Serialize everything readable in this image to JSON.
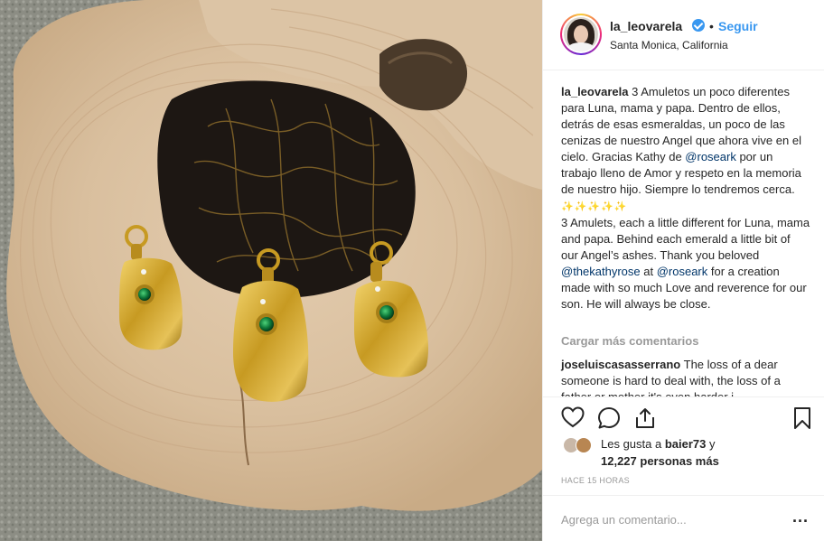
{
  "header": {
    "username": "la_leovarela",
    "separator": "•",
    "follow_label": "Seguir",
    "location": "Santa Monica, California"
  },
  "caption": {
    "username": "la_leovarela",
    "part1": "3 Amuletos un poco diferentes para Luna, mama y papa. Dentro de ellos, detrás de esas esmeraldas, un poco de las cenizas de nuestro Angel que ahora vive en el cielo. Gracias Kathy de ",
    "mention1": "@roseark",
    "part2": " por un trabajo lleno de Amor y respeto en la memoria de nuestro hijo. Siempre lo tendremos cerca. ",
    "sparkles": "✨✨✨✨✨",
    "part3": "3 Amulets, each a little different for Luna, mama and papa. Behind each emerald a little bit of our Angel’s ashes. Thank you beloved ",
    "mention2": "@thekathyrose",
    "part4": " at ",
    "mention3": "@roseark",
    "part5": " for a creation made with so much Love and reverence for our son. He will always be close."
  },
  "load_more": "Cargar más comentarios",
  "comment": {
    "username": "joseluiscasasserrano",
    "text": "The loss of a dear someone is hard to deal with, the loss of a father or mother it's even harder i"
  },
  "icons": {
    "like": "heart-icon",
    "comment": "comment-icon",
    "share": "share-icon",
    "save": "bookmark-icon",
    "more": "more-options-icon"
  },
  "likes": {
    "prefix": "Les gusta a ",
    "user": "baier73",
    "conj": " y",
    "count": "12,227 personas más"
  },
  "time": "HACE 15 HORAS",
  "add_comment": {
    "placeholder": "Agrega un comentario...",
    "options": "..."
  },
  "colors": {
    "link_blue": "#3897f0",
    "mention_blue": "#003569",
    "muted_gray": "#999999",
    "gold": "#c9a227",
    "emerald": "#0e7a3a"
  }
}
